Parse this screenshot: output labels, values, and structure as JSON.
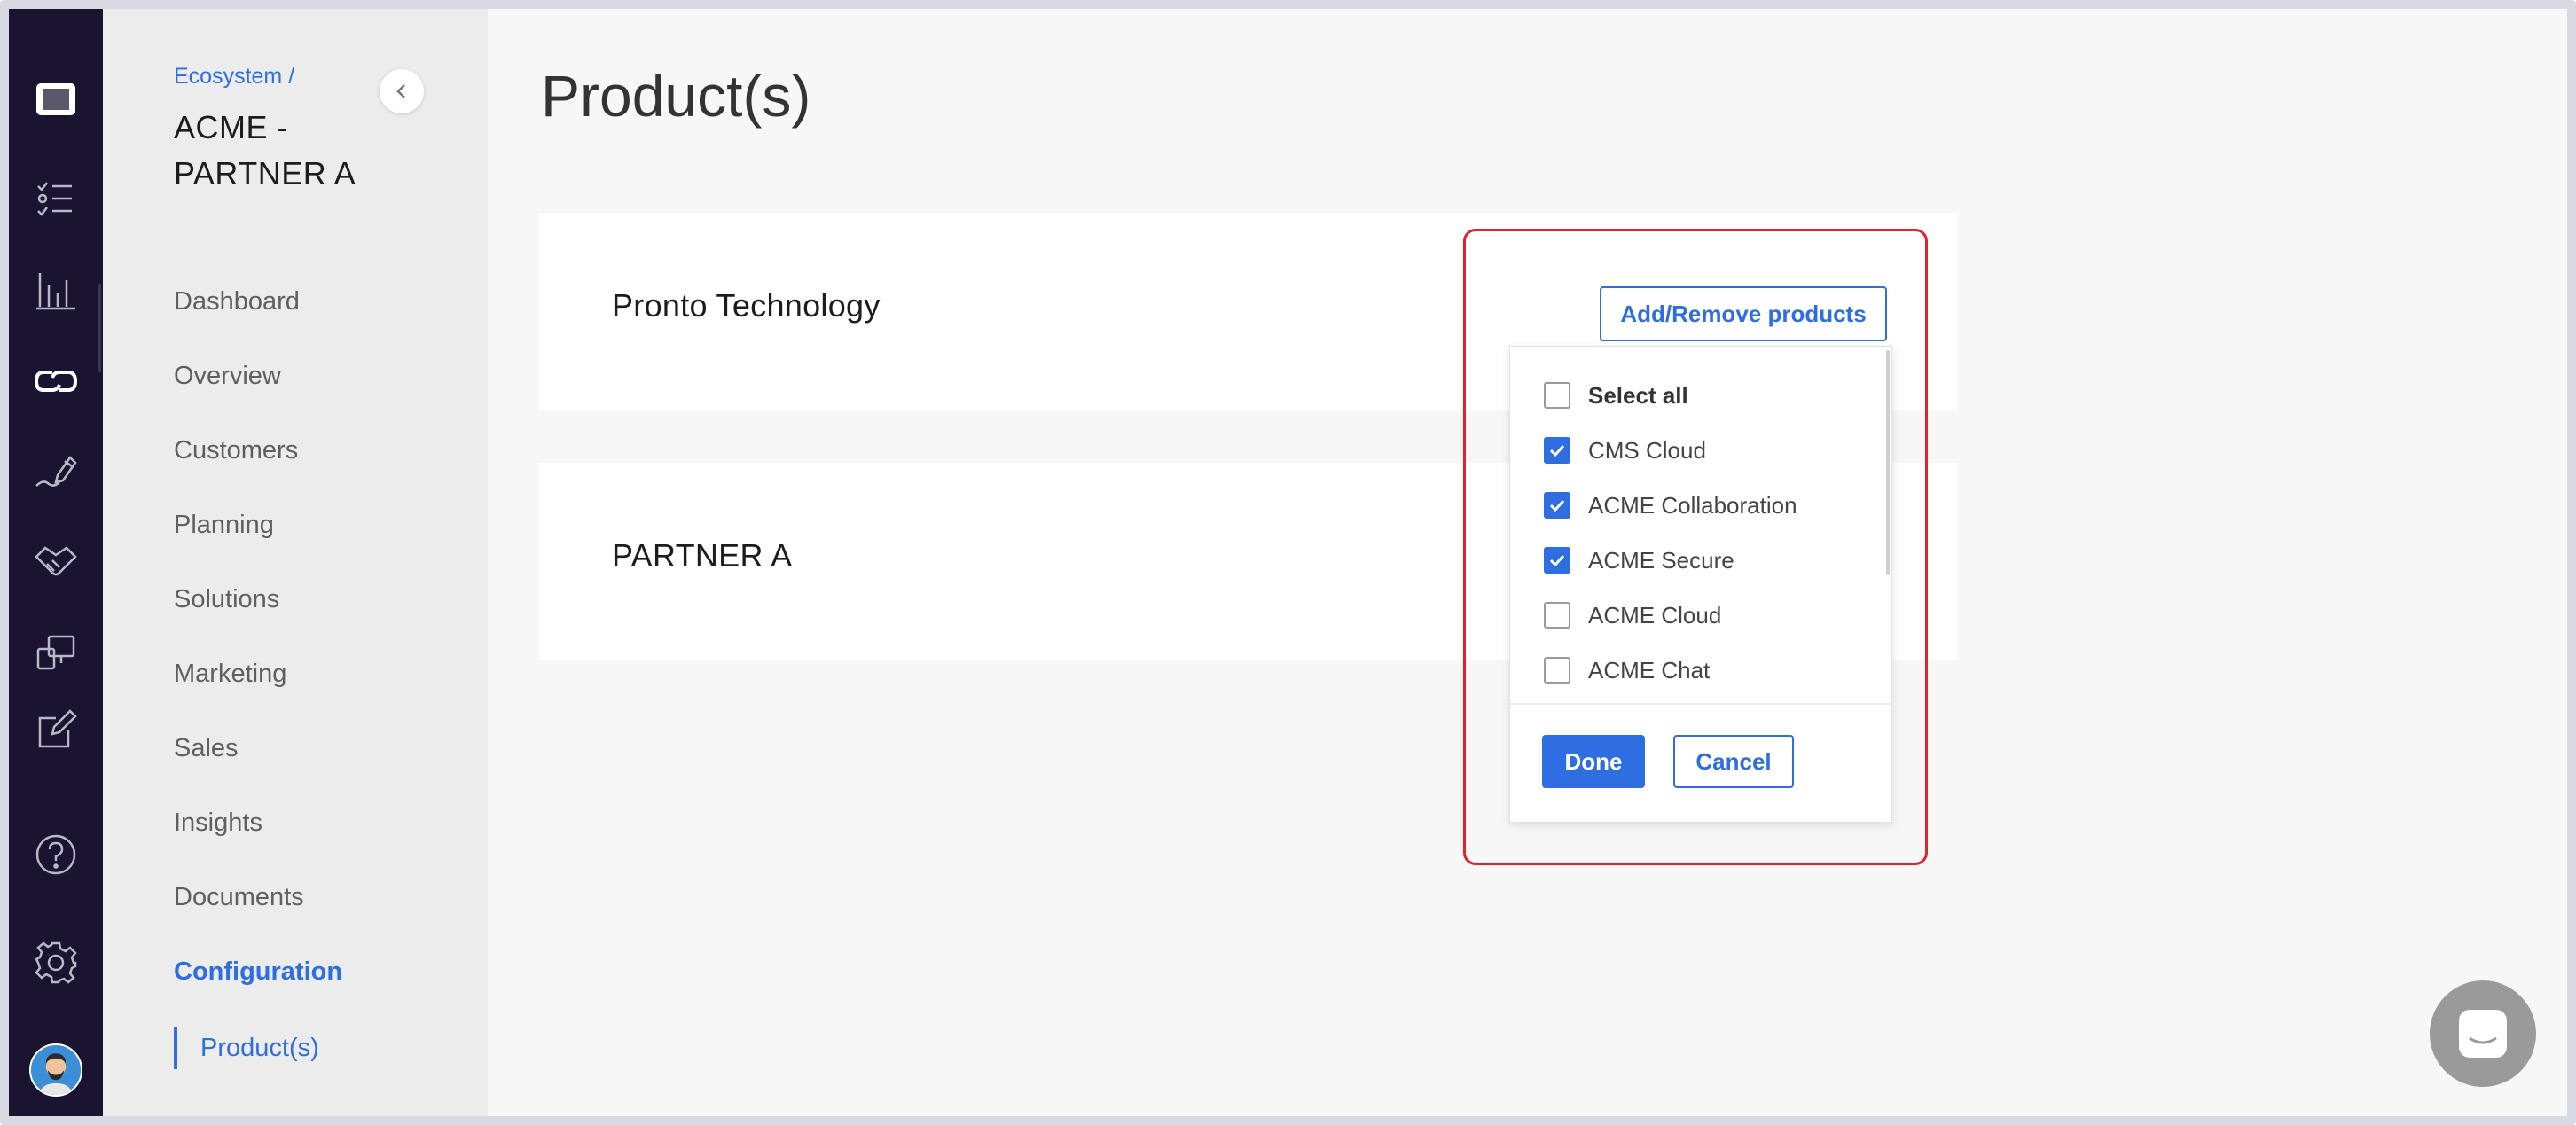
{
  "rail": {
    "icons": [
      "app-logo-icon",
      "tasks-icon",
      "analytics-icon",
      "ecosystem-icon",
      "sign-icon",
      "partners-icon",
      "devices-icon",
      "edit-icon",
      "help-icon",
      "settings-icon"
    ]
  },
  "sidebar": {
    "breadcrumb": "Ecosystem /",
    "title": "ACME - PARTNER A",
    "items": [
      {
        "label": "Dashboard"
      },
      {
        "label": "Overview"
      },
      {
        "label": "Customers"
      },
      {
        "label": "Planning"
      },
      {
        "label": "Solutions"
      },
      {
        "label": "Marketing"
      },
      {
        "label": "Sales"
      },
      {
        "label": "Insights"
      },
      {
        "label": "Documents"
      },
      {
        "label": "Configuration"
      }
    ],
    "sub_item": "Product(s)"
  },
  "main": {
    "title": "Product(s)",
    "cards": [
      {
        "name": "Pronto Technology"
      },
      {
        "name": "PARTNER A"
      }
    ],
    "add_button": "Add/Remove products"
  },
  "dropdown": {
    "options": [
      {
        "label": "Select all",
        "checked": false
      },
      {
        "label": "CMS Cloud",
        "checked": true
      },
      {
        "label": "ACME Collaboration",
        "checked": true
      },
      {
        "label": "ACME Secure",
        "checked": true
      },
      {
        "label": "ACME Cloud",
        "checked": false
      },
      {
        "label": "ACME Chat",
        "checked": false
      }
    ],
    "done": "Done",
    "cancel": "Cancel"
  },
  "colors": {
    "accent": "#2f6ee0",
    "rail_bg": "#1a1430",
    "highlight": "#e0242b"
  }
}
